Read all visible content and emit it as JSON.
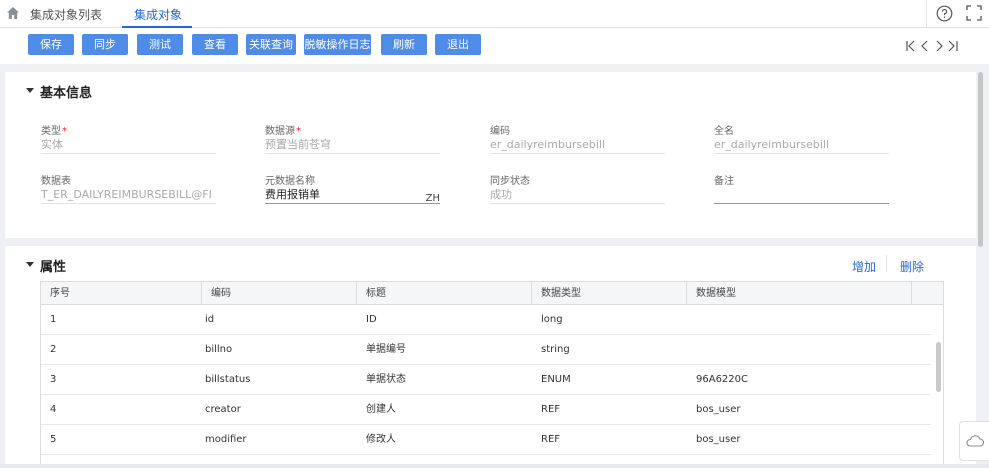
{
  "tabs": [
    {
      "label": "集成对象列表"
    },
    {
      "label": "集成对象"
    }
  ],
  "toolbar": {
    "buttons": [
      {
        "label": "保存"
      },
      {
        "label": "同步"
      },
      {
        "label": "测试"
      },
      {
        "label": "查看"
      },
      {
        "label": "关联查询"
      },
      {
        "label": "脱敏操作日志"
      },
      {
        "label": "刷新"
      },
      {
        "label": "退出"
      }
    ],
    "record_nav_icons": [
      "first-icon",
      "prev-icon",
      "next-icon",
      "last-icon"
    ],
    "accent_color": "#4e8ce8"
  },
  "basic": {
    "title": "基本信息",
    "fields": [
      {
        "label": "类型",
        "required": "*",
        "value": "实体"
      },
      {
        "label": "数据源",
        "required": "*",
        "value": "预置当前苍穹"
      },
      {
        "label": "编码",
        "value": "er_dailyreimbursebill"
      },
      {
        "label": "全名",
        "value": "er_dailyreimbursebill"
      },
      {
        "label": "数据表",
        "value": "T_ER_DAILYREIMBURSEBILL@FI"
      },
      {
        "label": "元数据名称",
        "value": "费用报销单",
        "lang": "ZH"
      },
      {
        "label": "同步状态",
        "value": "成功"
      },
      {
        "label": "备注",
        "value": ""
      }
    ]
  },
  "attrs": {
    "title": "属性",
    "add_label": "增加",
    "delete_label": "删除",
    "columns": [
      "序号",
      "编码",
      "标题",
      "数据类型",
      "数据模型"
    ],
    "rows": [
      [
        "1",
        "id",
        "ID",
        "long",
        ""
      ],
      [
        "2",
        "billno",
        "单据编号",
        "string",
        ""
      ],
      [
        "3",
        "billstatus",
        "单据状态",
        "ENUM",
        "96A6220C"
      ],
      [
        "4",
        "creator",
        "创建人",
        "REF",
        "bos_user"
      ],
      [
        "5",
        "modifier",
        "修改人",
        "REF",
        "bos_user"
      ]
    ]
  }
}
